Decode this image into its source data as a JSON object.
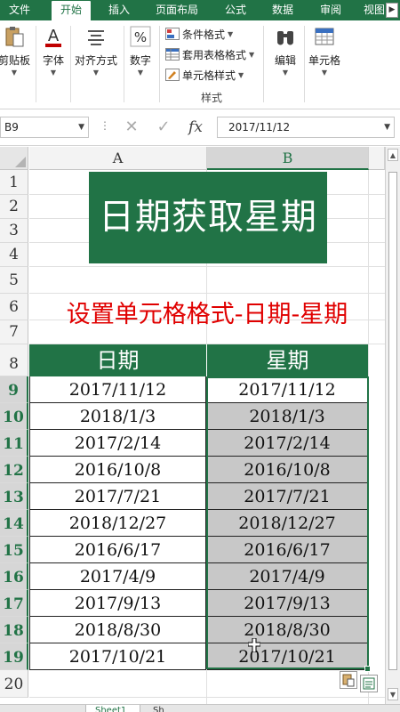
{
  "ribbon_tabs": [
    "文件",
    "开始",
    "插入",
    "页面布局",
    "公式",
    "数据",
    "审阅",
    "视图"
  ],
  "active_tab": "开始",
  "ribbon": {
    "clipboard": "剪贴板",
    "font": "字体",
    "alignment": "对齐方式",
    "number": "数字",
    "conditional_format": "条件格式",
    "table_format": "套用表格格式",
    "cell_styles": "单元格样式",
    "styles_group": "样式",
    "editing": "编辑",
    "cells": "单元格"
  },
  "formula_bar": {
    "name_box": "B9",
    "fx_label": "fx",
    "content": "2017/11/12"
  },
  "columns": [
    "A",
    "B"
  ],
  "rows": [
    "1",
    "2",
    "3",
    "4",
    "5",
    "6",
    "7",
    "8",
    "9",
    "10",
    "11",
    "12",
    "13",
    "14",
    "15",
    "16",
    "17",
    "18",
    "19",
    "20"
  ],
  "sheet": {
    "title": "日期获取星期",
    "subtitle": "设置单元格格式-日期-星期",
    "header_a": "日期",
    "header_b": "星期",
    "data": [
      [
        "2017/11/12",
        "2017/11/12"
      ],
      [
        "2018/1/3",
        "2018/1/3"
      ],
      [
        "2017/2/14",
        "2017/2/14"
      ],
      [
        "2016/10/8",
        "2016/10/8"
      ],
      [
        "2017/7/21",
        "2017/7/21"
      ],
      [
        "2018/12/27",
        "2018/12/27"
      ],
      [
        "2016/6/17",
        "2016/6/17"
      ],
      [
        "2017/4/9",
        "2017/4/9"
      ],
      [
        "2017/9/13",
        "2017/9/13"
      ],
      [
        "2018/8/30",
        "2018/8/30"
      ],
      [
        "2017/10/21",
        "2017/10/21"
      ]
    ]
  },
  "sheet_tabs": [
    "Sheet1",
    "Sh"
  ],
  "colors": {
    "accent": "#217346",
    "title_bg": "#217346",
    "subtitle": "#e00000",
    "selected_fill": "#c8c8c8"
  },
  "icons": {
    "clipboard": "clipboard-icon",
    "font": "font-a-icon",
    "alignment": "align-lines-icon",
    "number": "percent-icon",
    "editing": "binoculars-icon",
    "cells": "cells-grid-icon"
  }
}
